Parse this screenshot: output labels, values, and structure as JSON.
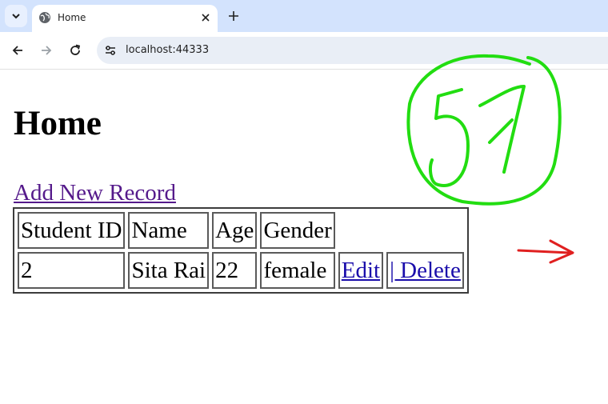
{
  "browser": {
    "tab_title": "Home",
    "url": "localhost:44333"
  },
  "page": {
    "heading": "Home",
    "add_link": "Add New Record",
    "table": {
      "headers": [
        "Student ID",
        "Name",
        "Age",
        "Gender"
      ],
      "rows": [
        {
          "id": "2",
          "name": "Sita Rai",
          "age": "22",
          "gender": "female",
          "edit": "Edit",
          "delete": "| Delete"
        }
      ]
    }
  },
  "annotations": {
    "circled_text": "57",
    "circle_color": "#22dd11",
    "arrow_color": "#e02020"
  }
}
